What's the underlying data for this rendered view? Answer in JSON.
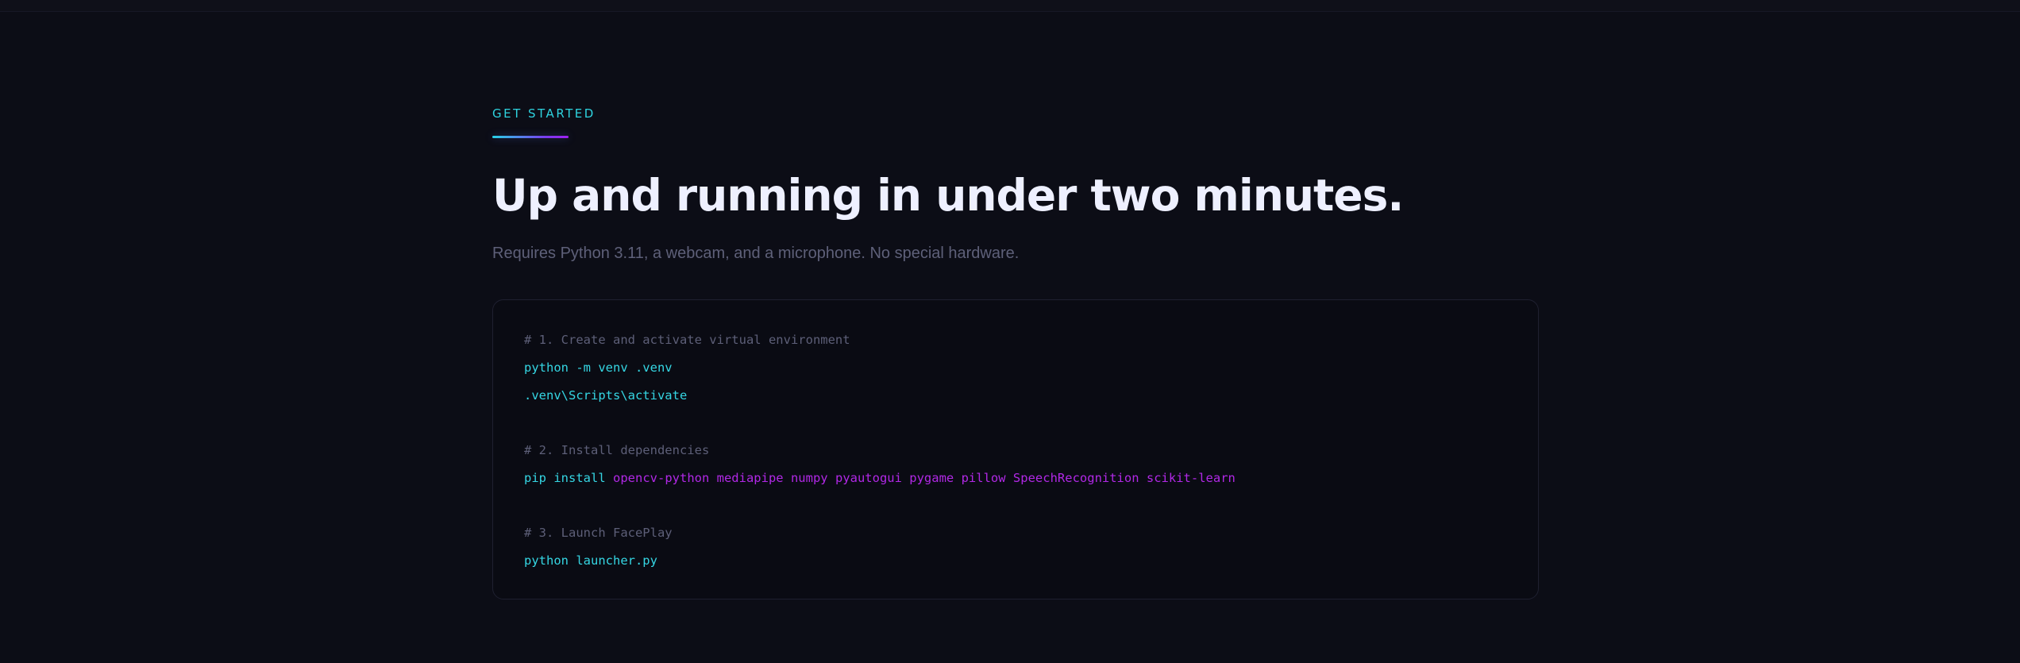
{
  "eyebrow": "GET STARTED",
  "title": "Up and running in under two minutes.",
  "subtitle": "Requires Python 3.11, a webcam, and a microphone. No special hardware.",
  "code": {
    "step1_comment": "# 1. Create and activate virtual environment",
    "step1_line1": "python -m venv .venv",
    "step1_line2": ".venv\\Scripts\\activate",
    "step2_comment": "# 2. Install dependencies",
    "step2_cmd": "pip install",
    "step2_packages": "opencv-python mediapipe numpy pyautogui pygame pillow SpeechRecognition scikit-learn",
    "step3_comment": "# 3. Launch FacePlay",
    "step3_line1": "python launcher.py"
  },
  "colors": {
    "background": "#0c0d16",
    "accent_cyan": "#2ed3df",
    "accent_purple": "#b128e6",
    "title": "#eef0ff",
    "muted": "#5e6079"
  }
}
